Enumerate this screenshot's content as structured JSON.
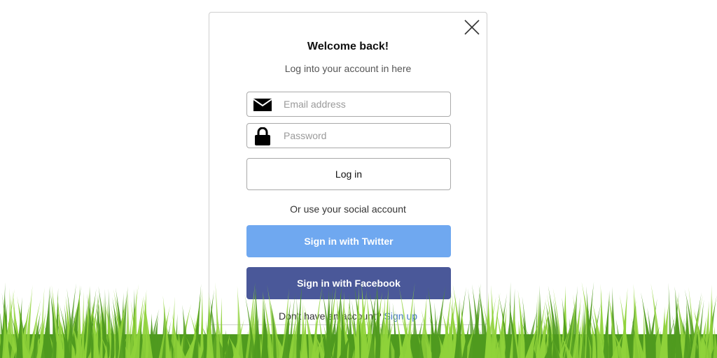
{
  "modal": {
    "title": "Welcome back!",
    "subtitle": "Log into your account in here",
    "close_icon": "close-icon",
    "email": {
      "placeholder": "Email address",
      "value": "",
      "icon": "envelope-icon"
    },
    "password": {
      "placeholder": "Password",
      "value": "",
      "icon": "lock-icon"
    },
    "login_label": "Log in",
    "social_label": "Or use your social account",
    "twitter_label": "Sign in with Twitter",
    "facebook_label": "Sign in with Facebook",
    "signup_prompt": "Don't have an account?",
    "signup_link": "Sign up"
  },
  "colors": {
    "twitter": "#6fa8f0",
    "facebook": "#4a5899",
    "link": "#4a7cc9",
    "grass_light": "#8fd23a",
    "grass_dark": "#4f9a1f"
  }
}
